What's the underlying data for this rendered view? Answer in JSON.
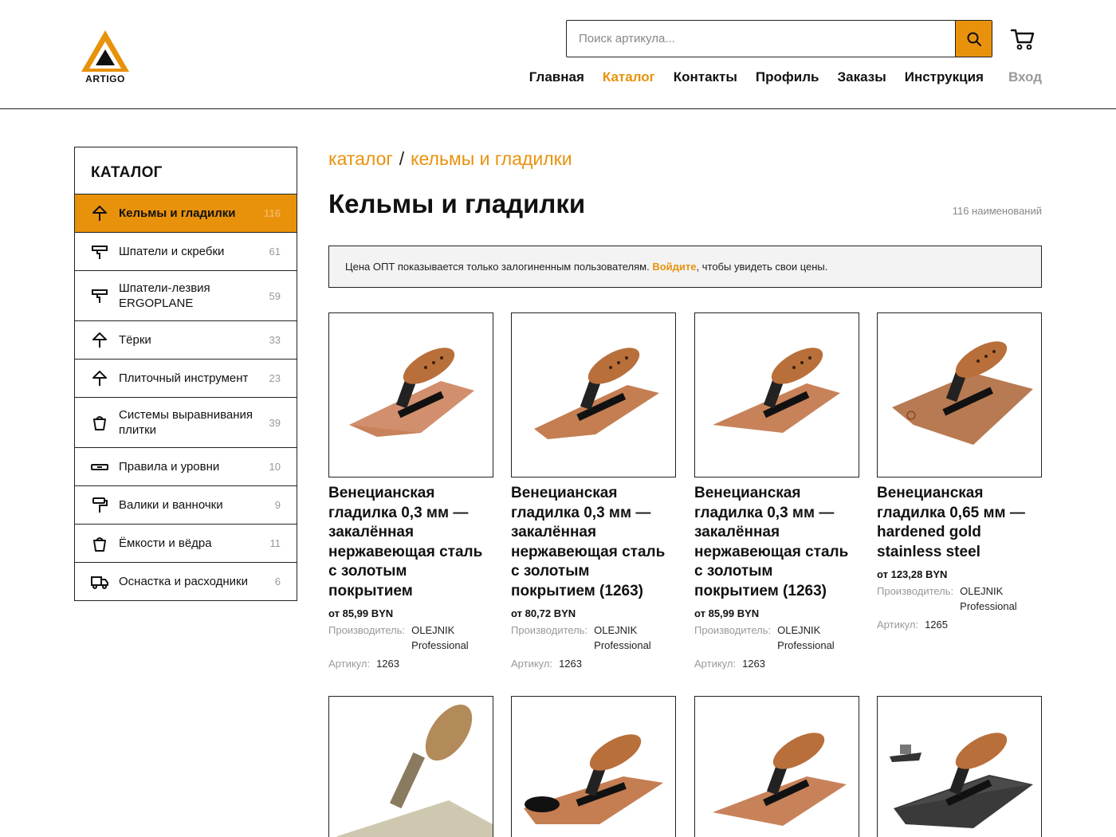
{
  "brand": {
    "name": "ARTIGO",
    "accent": "#e8920c"
  },
  "search": {
    "placeholder": "Поиск артикула..."
  },
  "nav": [
    {
      "label": "Главная",
      "state": "normal"
    },
    {
      "label": "Каталог",
      "state": "active"
    },
    {
      "label": "Контакты",
      "state": "normal"
    },
    {
      "label": "Профиль",
      "state": "normal"
    },
    {
      "label": "Заказы",
      "state": "normal"
    },
    {
      "label": "Инструкция",
      "state": "normal"
    },
    {
      "label": "Вход",
      "state": "muted"
    }
  ],
  "sidebar": {
    "title": "КАТАЛОГ",
    "items": [
      {
        "label": "Кельмы и гладилки",
        "count": "116",
        "icon": "trowel-icon",
        "active": true
      },
      {
        "label": "Шпатели и скребки",
        "count": "61",
        "icon": "spatula-icon",
        "active": false
      },
      {
        "label": "Шпатели-лезвия ERGOPLANE",
        "count": "59",
        "icon": "spatula-icon",
        "active": false
      },
      {
        "label": "Тёрки",
        "count": "33",
        "icon": "trowel-icon",
        "active": false
      },
      {
        "label": "Плиточный инструмент",
        "count": "23",
        "icon": "trowel-icon",
        "active": false
      },
      {
        "label": "Системы выравнивания плитки",
        "count": "39",
        "icon": "bucket-icon",
        "active": false
      },
      {
        "label": "Правила и уровни",
        "count": "10",
        "icon": "level-icon",
        "active": false
      },
      {
        "label": "Валики и ванночки",
        "count": "9",
        "icon": "roller-icon",
        "active": false
      },
      {
        "label": "Ёмкости и вёдра",
        "count": "11",
        "icon": "bucket-icon",
        "active": false
      },
      {
        "label": "Оснастка и расходники",
        "count": "6",
        "icon": "truck-icon",
        "active": false
      }
    ]
  },
  "breadcrumb": {
    "root": "каталог",
    "separator": "/",
    "current": "кельмы и гладилки"
  },
  "page": {
    "title": "Кельмы и гладилки",
    "count": "116 наименований"
  },
  "notice": {
    "before": "Цена ОПТ показывается только залогиненным пользователям. ",
    "link": "Войдите",
    "after": ", чтобы увидеть свои цены."
  },
  "labels": {
    "manufacturer": "Производитель:",
    "article": "Артикул:"
  },
  "products": [
    {
      "name": "Венецианская гладилка 0,3 мм — закалённая нержавеющая сталь с золотым покрытием",
      "price": "от 85,99 BYN",
      "manufacturer": "OLEJNIK Professional",
      "article": "1263"
    },
    {
      "name": "Венецианская гладилка 0,3 мм — закалённая нержавеющая сталь с золотым покрытием (1263)",
      "price": "от 80,72 BYN",
      "manufacturer": "OLEJNIK Professional",
      "article": "1263"
    },
    {
      "name": "Венецианская гладилка 0,3 мм — закалённая нержавеющая сталь с золотым покрытием (1263)",
      "price": "от 85,99 BYN",
      "manufacturer": "OLEJNIK Professional",
      "article": "1263"
    },
    {
      "name": "Венецианская гладилка 0,65 мм — hardened gold stainless steel",
      "price": "от 123,28 BYN",
      "manufacturer": "OLEJNIK Professional",
      "article": "1265"
    }
  ]
}
